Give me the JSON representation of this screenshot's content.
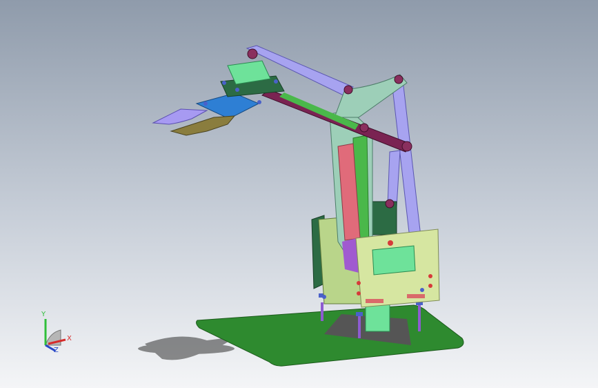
{
  "viewport": {
    "background_top": "#8f9bab",
    "background_bottom": "#f4f5f7"
  },
  "model": {
    "colors": {
      "base_plate": "#2e8a2f",
      "upper_link": "#a7a3f0",
      "forearm_link": "#7a2352",
      "gripper_plate": "#2e7fd4",
      "gripper_jaw_upper": "#a79af2",
      "gripper_jaw_lower": "#8a7d3e",
      "servo": "#6ee29a",
      "body_panel": "#d6e6a1",
      "side_plate": "#2c6b44",
      "vertical_plate": "#e06b7a",
      "bracket": "#9dcfb8",
      "bolt": "#4a61c9",
      "leg": "#8d5bd0"
    }
  },
  "triad": {
    "x_label": "X",
    "y_label": "Y",
    "z_label": "Z",
    "x_color": "#d62c2c",
    "y_color": "#2fbf3a",
    "z_color": "#2646c7",
    "origin_icon": "triad-origin-icon"
  }
}
